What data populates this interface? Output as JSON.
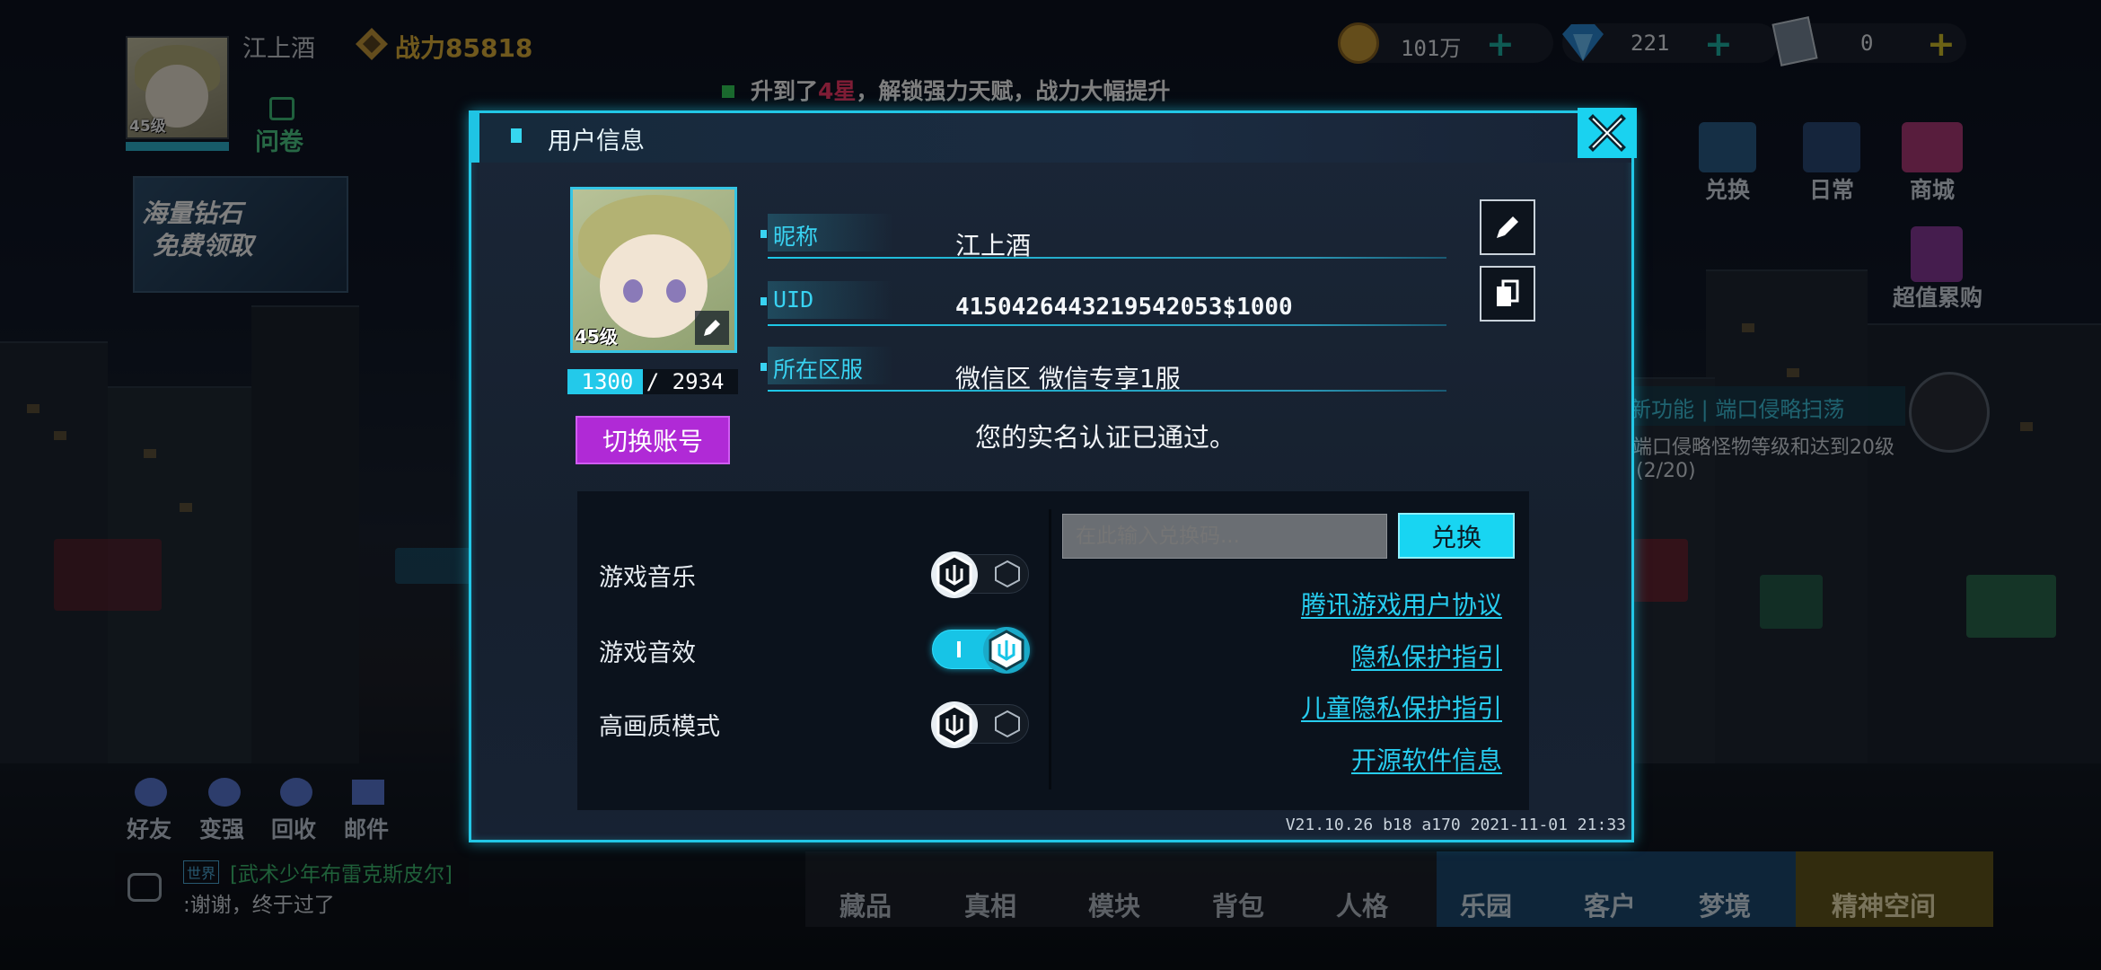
{
  "hud": {
    "player_name": "江上酒",
    "avatar_level": "45级",
    "power_label": "战力85818",
    "questionnaire": "问卷",
    "gold": "101万",
    "diamonds": "221",
    "tickets": "0",
    "promo_line1": "海量钻石",
    "promo_line2": "免费领取"
  },
  "ticker": {
    "before": "升到了",
    "highlight": "4星",
    "after": "，解锁强力天赋，战力大幅提升"
  },
  "right_menu": {
    "exchange": "兑换",
    "daily": "日常",
    "shop": "商城",
    "recharge": "超值累购"
  },
  "quest": {
    "title": "新功能 | 端口侵略扫荡",
    "desc": "端口侵略怪物等级和达到20级",
    "progress": "(2/20)"
  },
  "bottom_left": {
    "friends": "好友",
    "strengthen": "变强",
    "recycle": "回收",
    "mail": "邮件",
    "chat_channel": "世界",
    "chat_user": "[武术少年布雷克斯皮尔]",
    "chat_msg": ":谢谢，终于过了"
  },
  "bottom_nav": [
    "藏品",
    "真相",
    "模块",
    "背包",
    "人格",
    "乐园",
    "客户",
    "梦境",
    "精神空间"
  ],
  "dialog": {
    "title": "用户信息",
    "level": "45级",
    "exp_current": "1300",
    "exp_total": "2934",
    "exp_fraction": 0.443,
    "exp_text": "1300 / 2934",
    "switch_account": "切换账号",
    "nickname_label": "昵称",
    "nickname": "江上酒",
    "uid_label": "UID",
    "uid": "4150426443219542053$1000",
    "server_label": "所在区服",
    "server": "微信区  微信专享1服",
    "realname_status": "您的实名认证已通过。",
    "settings": [
      {
        "label": "游戏音乐",
        "on": false
      },
      {
        "label": "游戏音效",
        "on": true
      },
      {
        "label": "高画质模式",
        "on": false
      }
    ],
    "redeem_placeholder": "在此输入兑换码...",
    "redeem_button": "兑换",
    "links": [
      "腾讯游戏用户协议",
      "隐私保护指引",
      "儿童隐私保护指引",
      "开源软件信息"
    ],
    "version": "V21.10.26 b18 a170 2021-11-01 21:33"
  },
  "colors": {
    "accent": "#22c7e6",
    "switch_button": "#b02ad6",
    "power": "#e0b23a",
    "ticker_highlight": "#ff3a6a"
  }
}
